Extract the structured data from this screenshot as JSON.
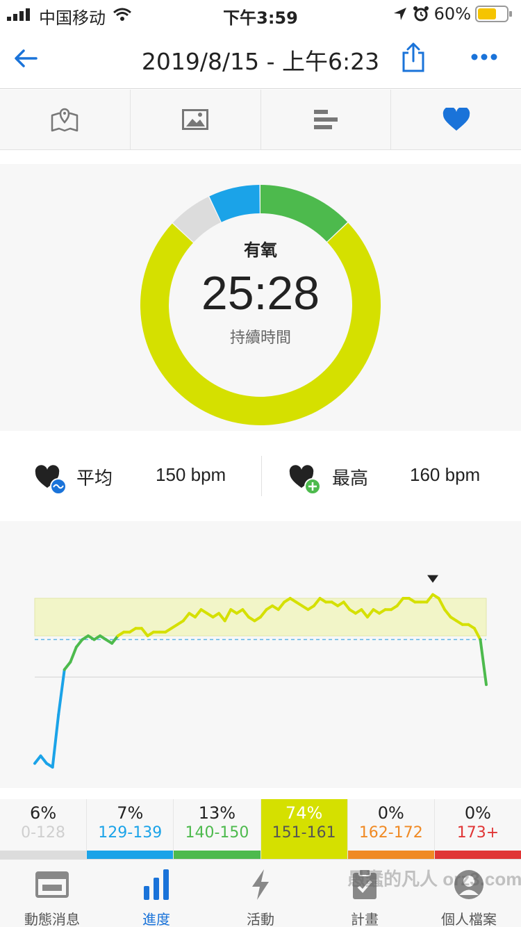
{
  "status_bar": {
    "carrier": "中国移动",
    "time": "下午3:59",
    "battery_percent": "60%"
  },
  "nav": {
    "title": "2019/8/15 - 上午6:23"
  },
  "tabs": [
    {
      "name": "map",
      "icon": "map-icon"
    },
    {
      "name": "photos",
      "icon": "image-icon"
    },
    {
      "name": "splits",
      "icon": "bars-icon"
    },
    {
      "name": "heart-rate",
      "icon": "heart-icon",
      "active": true
    }
  ],
  "ring": {
    "zone_name": "有氧",
    "duration": "25:28",
    "duration_label": "持續時間"
  },
  "stats": {
    "average_label": "平均",
    "average_value": "150 bpm",
    "max_label": "最高",
    "max_value": "160 bpm"
  },
  "zones": [
    {
      "percent": "6%",
      "range": "0-128",
      "color": "#dcdcdc",
      "value": 6
    },
    {
      "percent": "7%",
      "range": "129-139",
      "color": "#1ba3e8",
      "value": 7
    },
    {
      "percent": "13%",
      "range": "140-150",
      "color": "#4dba4d",
      "value": 13
    },
    {
      "percent": "74%",
      "range": "151-161",
      "color": "#d5e000",
      "value": 74,
      "active": true
    },
    {
      "percent": "0%",
      "range": "162-172",
      "color": "#f08a24",
      "value": 0
    },
    {
      "percent": "0%",
      "range": "173+",
      "color": "#e03535",
      "value": 0
    }
  ],
  "bottom_tabs": [
    {
      "label": "動態消息",
      "icon": "news-feed-icon"
    },
    {
      "label": "進度",
      "icon": "progress-bars-icon",
      "active": true
    },
    {
      "label": "活動",
      "icon": "lightning-icon"
    },
    {
      "label": "計畫",
      "icon": "clipboard-icon"
    },
    {
      "label": "個人檔案",
      "icon": "profile-icon"
    }
  ],
  "watermark": "愚蠢的凡人 orz3.com",
  "colors": {
    "accent": "#1a73d9",
    "zone_highlight": "#d5e000",
    "zone_band": "#f2f5c8",
    "average_line": "#5fb6e6"
  },
  "chart_data": {
    "type": "line",
    "title": "",
    "xlabel": "",
    "ylabel": "",
    "ylim": [
      116,
      166
    ],
    "highlight_band": [
      151,
      161
    ],
    "average_line": 150,
    "max_marker_index": 67,
    "series": [
      {
        "values": [
          117,
          119,
          117,
          116,
          130,
          142,
          144,
          148,
          150,
          151,
          150,
          151,
          150,
          149,
          151,
          152,
          152,
          153,
          153,
          151,
          152,
          152,
          152,
          153,
          154,
          155,
          157,
          156,
          158,
          157,
          156,
          157,
          155,
          158,
          157,
          158,
          156,
          155,
          156,
          158,
          159,
          158,
          160,
          161,
          160,
          159,
          158,
          159,
          161,
          160,
          160,
          159,
          160,
          158,
          157,
          158,
          156,
          158,
          157,
          158,
          158,
          159,
          161,
          161,
          160,
          160,
          160,
          162,
          161,
          158,
          156,
          155,
          154,
          154,
          153,
          150,
          138
        ]
      }
    ]
  }
}
